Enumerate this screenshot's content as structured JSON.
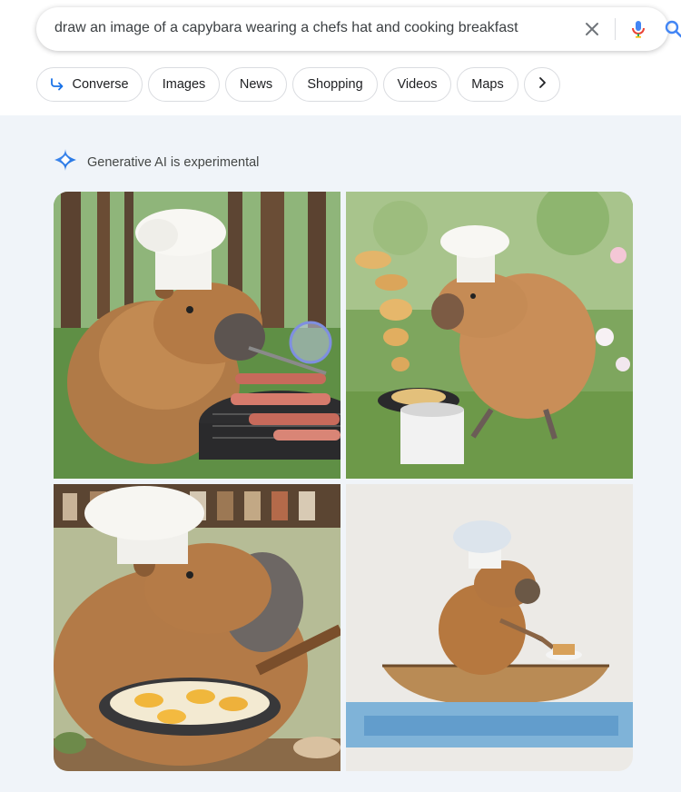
{
  "search": {
    "query": "draw an image of a capybara wearing a chefs hat and cooking breakfast"
  },
  "icons": {
    "clear": "close-icon",
    "mic": "microphone-icon",
    "search": "search-icon",
    "converse": "reply-arrow-icon",
    "next": "chevron-right-icon",
    "ai": "gemini-sparkle-icon"
  },
  "chips": [
    {
      "label": "Converse"
    },
    {
      "label": "Images"
    },
    {
      "label": "News"
    },
    {
      "label": "Shopping"
    },
    {
      "label": "Videos"
    },
    {
      "label": "Maps"
    }
  ],
  "ai_section": {
    "label": "Generative AI is experimental"
  },
  "colors": {
    "accent": "#1a73e8",
    "panel_bg": "#f0f4f9"
  }
}
